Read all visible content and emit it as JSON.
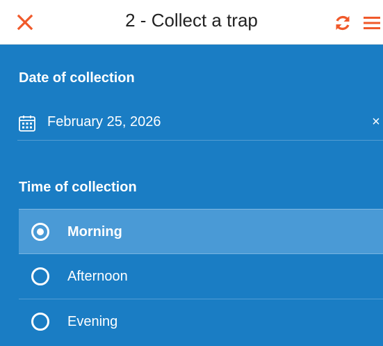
{
  "header": {
    "title": "2 - Collect a trap",
    "close_icon": "close-icon",
    "refresh_icon": "refresh-icon",
    "menu_icon": "menu-icon",
    "accent_color": "#f0592a"
  },
  "form": {
    "background_color": "#1a7dc4",
    "date_field": {
      "label": "Date of collection",
      "value": "February 25, 2026",
      "icon": "calendar-icon",
      "clear_icon": "clear-icon",
      "clear_glyph": "×"
    },
    "time_field": {
      "label": "Time of collection",
      "options": [
        {
          "label": "Morning",
          "selected": true
        },
        {
          "label": "Afternoon",
          "selected": false
        },
        {
          "label": "Evening",
          "selected": false
        }
      ]
    }
  }
}
